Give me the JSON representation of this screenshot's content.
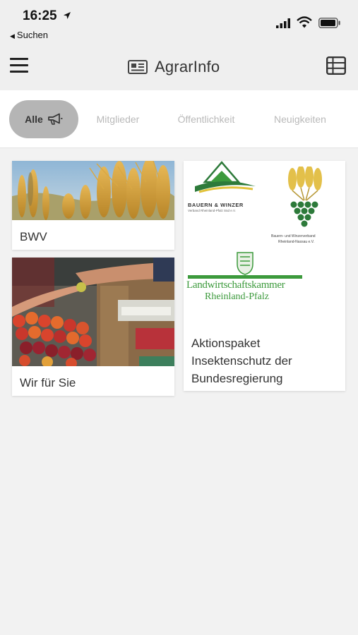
{
  "status_bar": {
    "time": "16:25",
    "back_label": "Suchen"
  },
  "header": {
    "title": "AgrarInfo",
    "title_icon": "newspaper-icon",
    "menu_icon": "hamburger-menu-icon",
    "view_icon": "table-view-icon"
  },
  "filters": {
    "tabs": [
      {
        "label": "Alle",
        "icon": "megaphone-icon",
        "active": true
      },
      {
        "label": "Mitglieder"
      },
      {
        "label": "Öffentlichkeit"
      },
      {
        "label": "Neuigkeiten"
      }
    ]
  },
  "cards": [
    {
      "label": "BWV",
      "image": "wheat-field-photo"
    },
    {
      "label": "Wir für Sie",
      "image": "market-stall-photo"
    },
    {
      "label": "Aktionspaket Insektenschutz der Bundesregierung",
      "image": "organization-logos",
      "logos": {
        "logo1_line1": "BAUERN & WINZER",
        "logo1_line2": "Verband Rheinland-Pfalz Süd e.V.",
        "logo2_line1": "Bauern- und Winzerverband",
        "logo2_line2": "Rheinland-Nassau e.V.",
        "logo3_line1": "Landwirtschaftskammer",
        "logo3_line2": "Rheinland-Pfalz"
      }
    }
  ],
  "colors": {
    "background": "#f2f2f2",
    "active_tab": "#b5b5b5",
    "inactive_tab_text": "#b9b9b9",
    "logo_green": "#3c9a3c"
  }
}
